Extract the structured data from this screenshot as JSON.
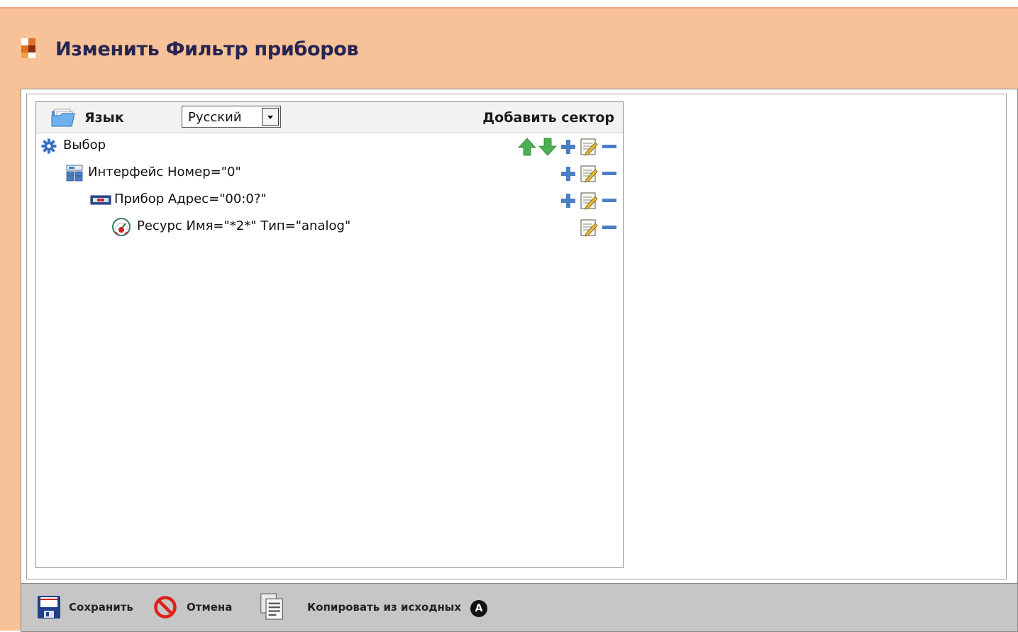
{
  "window": {
    "title": "Изменить Фильтр приборов",
    "logo_icon": "orange-checker-logo-icon"
  },
  "header": {
    "language_label": "Язык",
    "language_value": "Русский",
    "add_sector_label": "Добавить сектор"
  },
  "tree": {
    "rows": [
      {
        "label": "Выбор",
        "icon": "gear-icon",
        "actions": [
          "arrow-up-icon",
          "arrow-down-icon",
          "plus-icon",
          "edit-icon",
          "minus-icon"
        ]
      },
      {
        "label": "Интерфейс Номер=\"0\"",
        "icon": "interface-icon",
        "actions": [
          "plus-icon",
          "edit-icon",
          "minus-icon"
        ]
      },
      {
        "label": "Прибор Адрес=\"00:0?\"",
        "icon": "device-icon",
        "actions": [
          "plus-icon",
          "edit-icon",
          "minus-icon"
        ]
      },
      {
        "label": "Ресурс Имя=\"*2*\" Тип=\"analog\"",
        "icon": "resource-gauge-icon",
        "actions": [
          "edit-icon",
          "minus-icon"
        ]
      }
    ]
  },
  "footer": {
    "save_label": "Сохранить",
    "cancel_label": "Отмена",
    "copy_label": "Копировать из исходных",
    "callout_label": "A"
  },
  "colors": {
    "background": "#f7c298",
    "title": "#262453",
    "bottom_bar": "#c6c6c6",
    "arrow_green": "#4caf50",
    "action_blue": "#4a7fc1"
  }
}
